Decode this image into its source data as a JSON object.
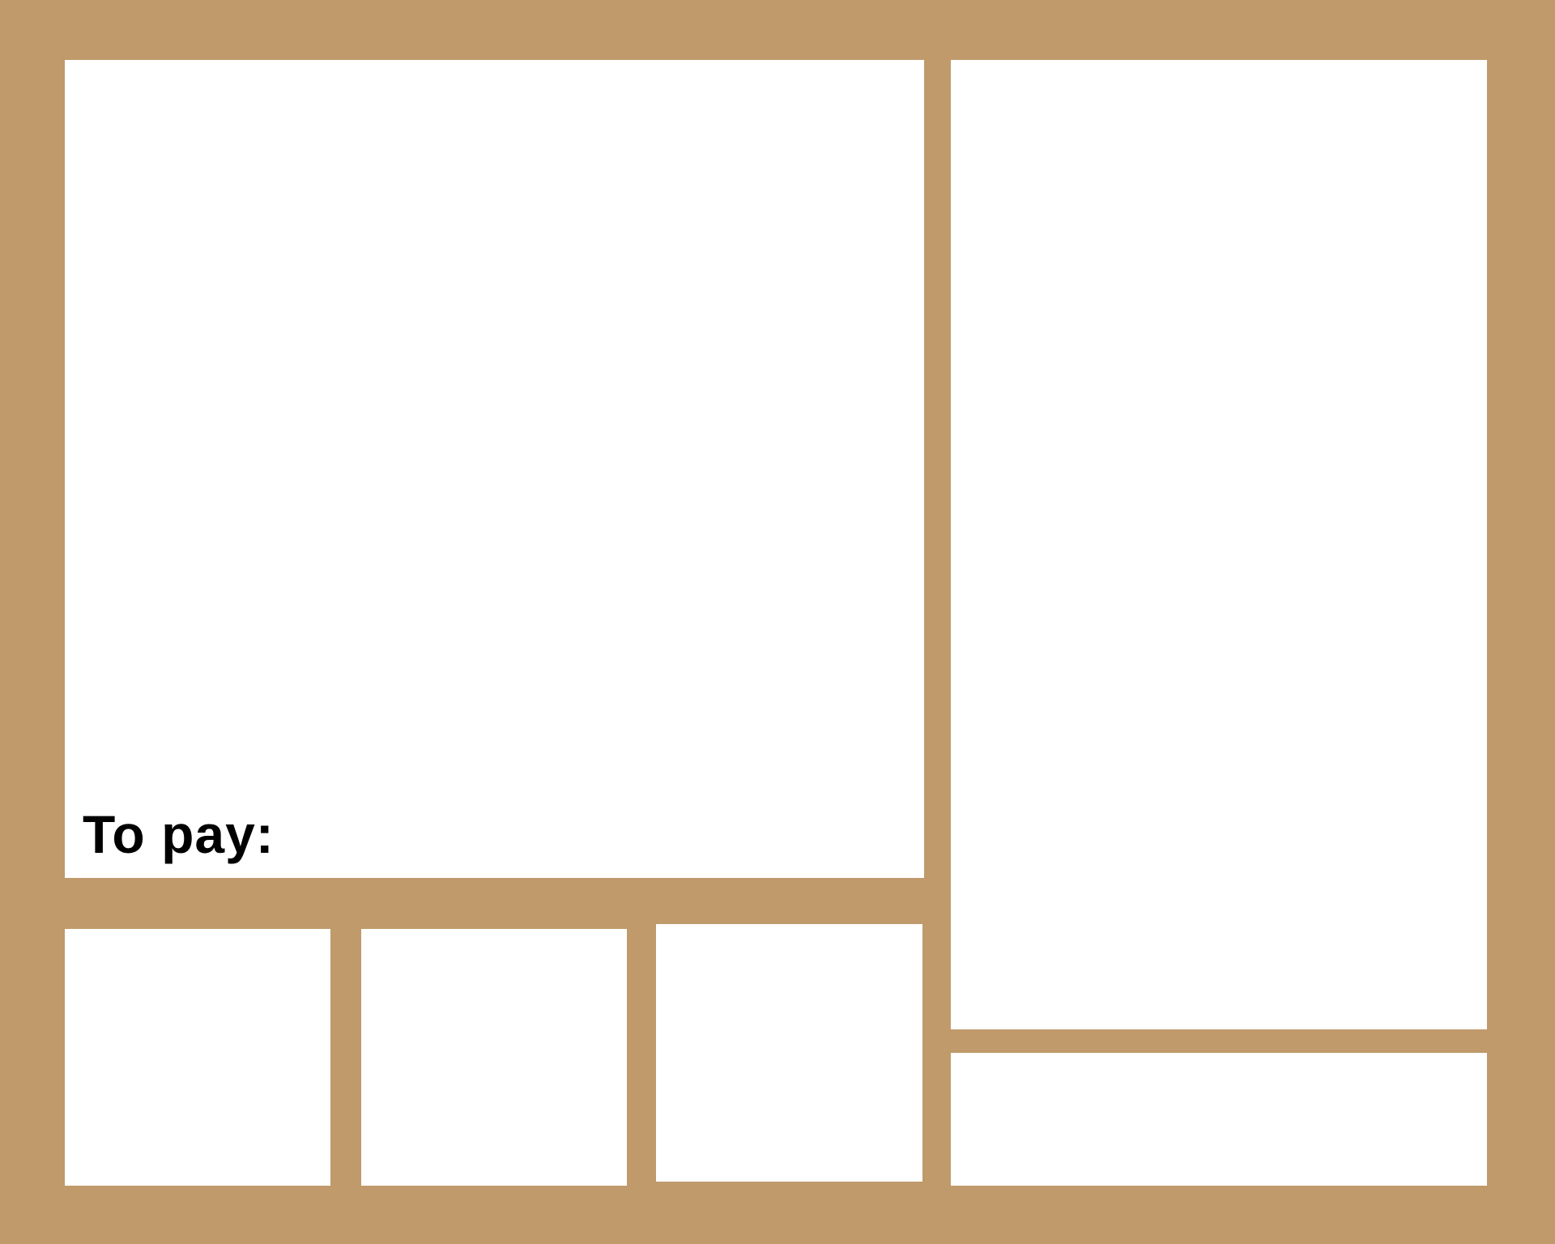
{
  "colors": {
    "background": "#c09a6b",
    "panel": "#ffffff",
    "text": "#000000"
  },
  "main_panel": {
    "to_pay_label": "To pay:"
  }
}
